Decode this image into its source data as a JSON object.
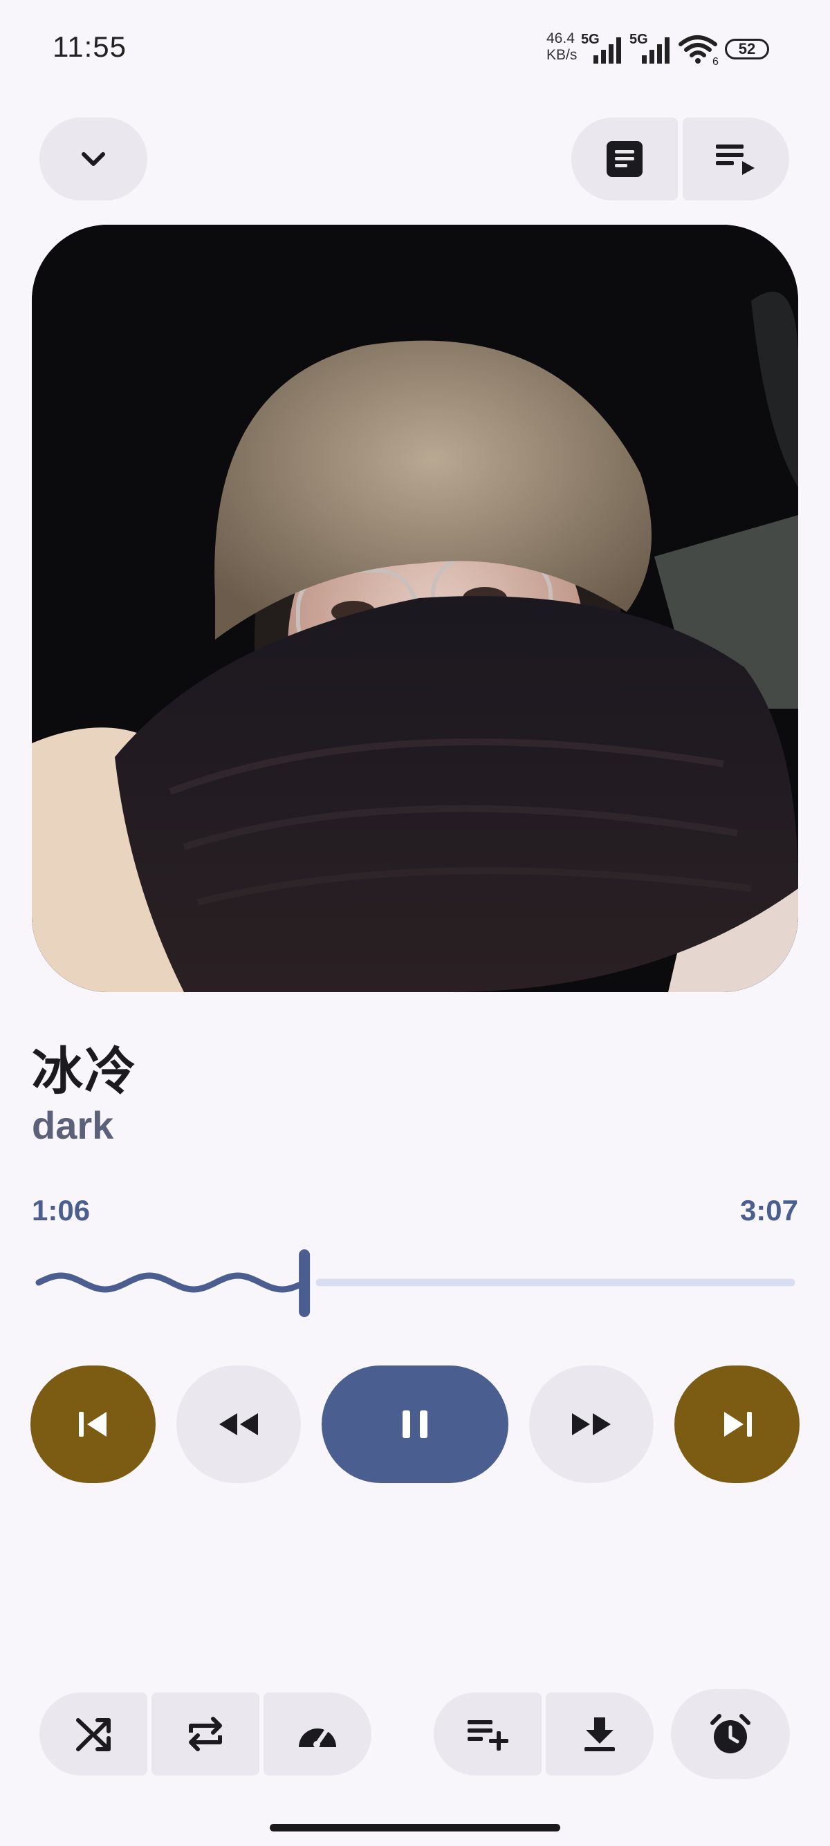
{
  "status_bar": {
    "time": "11:55",
    "net_speed_value": "46.4",
    "net_speed_unit": "KB/s",
    "signal1_label": "5G",
    "signal2_label": "5G",
    "wifi_label": "6",
    "battery": "52"
  },
  "header": {
    "collapse_icon": "chevron-down-icon",
    "lyrics_icon": "lyrics-icon",
    "queue_icon": "queue-music-icon"
  },
  "track": {
    "title": "冰冷",
    "artist": "dark"
  },
  "progress": {
    "current": "1:06",
    "total": "3:07",
    "fraction": 0.353
  },
  "controls": {
    "previous_icon": "skip-previous-icon",
    "rewind_icon": "rewind-icon",
    "pause_icon": "pause-icon",
    "fast_forward_icon": "fast-forward-icon",
    "next_icon": "skip-next-icon"
  },
  "toolbar": {
    "shuffle_icon": "shuffle-icon",
    "repeat_icon": "repeat-icon",
    "speed_icon": "speedometer-icon",
    "add_to_queue_icon": "playlist-add-icon",
    "download_icon": "download-icon",
    "timer_icon": "alarm-icon"
  },
  "colors": {
    "background": "#f8f5fb",
    "accent_blue": "#4a5f8f",
    "accent_gold": "#7c5c12",
    "button_bg": "#ebe7ef",
    "track_inactive": "#d8def0"
  }
}
